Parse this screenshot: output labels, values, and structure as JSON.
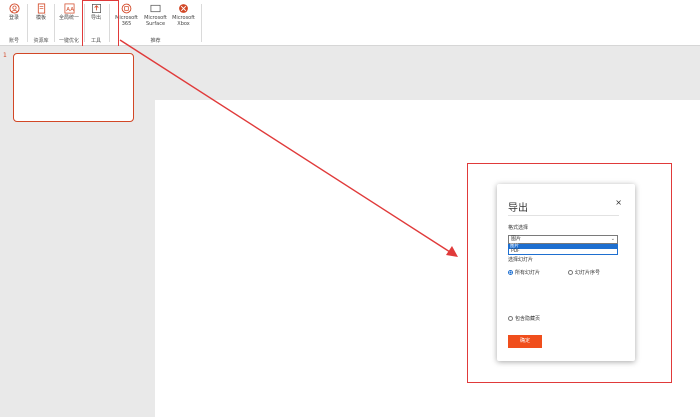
{
  "ribbon": {
    "buttons": [
      {
        "label": "登录",
        "icon": "user-icon"
      },
      {
        "label": "模板",
        "icon": "template-icon"
      },
      {
        "label": "全局统一",
        "icon": "font-icon"
      },
      {
        "label": "导出",
        "icon": "export-icon"
      },
      {
        "label": "Microsoft 365",
        "icon": "office-icon"
      },
      {
        "label": "Microsoft Surface",
        "icon": "surface-icon"
      },
      {
        "label": "Microsoft Xbox",
        "icon": "xbox-icon"
      }
    ],
    "groups": [
      "账号",
      "资源库",
      "一键优化",
      "工具",
      "推荐"
    ]
  },
  "slide_panel": {
    "number": "1"
  },
  "dialog": {
    "title": "导出",
    "close": "×",
    "format_label": "格式选择",
    "format_value": "图片",
    "format_options": [
      "图片",
      "PDF"
    ],
    "range_label": "选择幻灯片",
    "radio_all": "所有幻灯片",
    "radio_custom": "幻灯片序号",
    "checkbox_label": "包含隐藏页",
    "ok_label": "确定"
  },
  "colors": {
    "accent": "#d24726",
    "highlight": "#e03a3a",
    "button": "#f04e1c",
    "select": "#1e6fd0"
  }
}
